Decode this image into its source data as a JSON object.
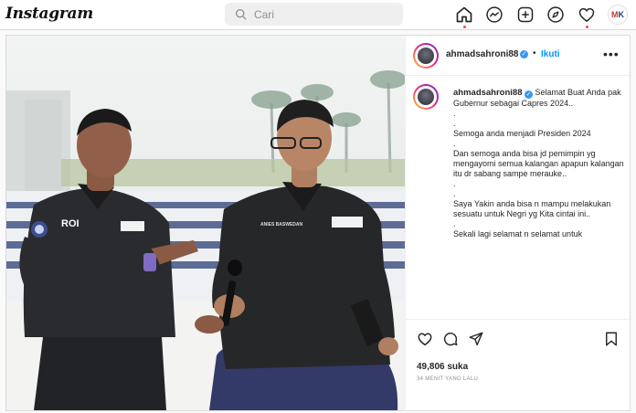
{
  "topbar": {
    "brand": "Instagram",
    "search_placeholder": "Cari"
  },
  "post": {
    "author": "ahmadsahroni88",
    "follow_label": "Ikuti",
    "more_label": "•••",
    "caption": [
      "Selamat Buat Anda pak Gubernur sebagai Capres 2024..",
      ".",
      ".",
      "Semoga anda menjadi Presiden 2024",
      ".",
      "Dan semoga anda bisa jd pemimpin yg mengayomi semua kalangan apapun kalangan itu dr sabang sampe merauke..",
      ".",
      ".",
      "Saya Yakin anda bisa n mampu melakukan sesuatu untuk Negri yg Kita cintai ini..",
      ".",
      "Sekali lagi selamat n selamat untuk"
    ],
    "likes": "49,806 suka",
    "time_ago": "34 MENIT YANG LALU",
    "photo_text": {
      "left_shirt": "ROI",
      "right_badge": "ANIES BASWEDAN"
    }
  },
  "colors": {
    "link": "#0095f6",
    "notif": "#ed4956",
    "verified": "#3897f0"
  }
}
